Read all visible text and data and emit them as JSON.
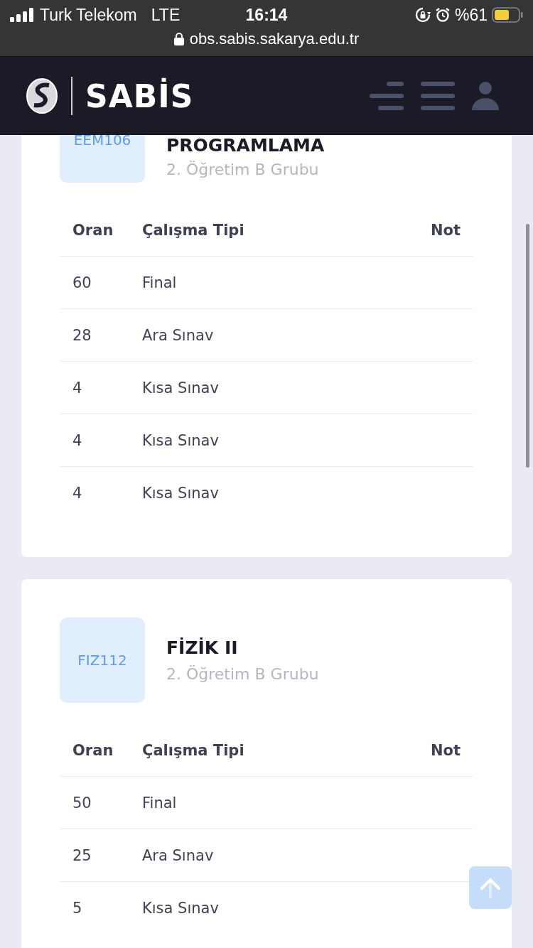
{
  "status_bar": {
    "carrier": "Turk Telekom",
    "network": "LTE",
    "time": "16:14",
    "battery_text": "%61",
    "url": "obs.sabis.sakarya.edu.tr"
  },
  "header": {
    "logo_text": "SABİS"
  },
  "courses": [
    {
      "code": "EEM106",
      "title": "PROGRAMLAMA",
      "group": "2. Öğretim B Grubu",
      "columns": [
        "Oran",
        "Çalışma Tipi",
        "Not"
      ],
      "rows": [
        {
          "rate": "60",
          "type": "Final"
        },
        {
          "rate": "28",
          "type": "Ara Sınav"
        },
        {
          "rate": "4",
          "type": "Kısa Sınav"
        },
        {
          "rate": "4",
          "type": "Kısa Sınav"
        },
        {
          "rate": "4",
          "type": "Kısa Sınav"
        }
      ]
    },
    {
      "code": "FIZ112",
      "title": "FİZİK II",
      "group": "2. Öğretim B Grubu",
      "columns": [
        "Oran",
        "Çalışma Tipi",
        "Not"
      ],
      "rows": [
        {
          "rate": "50",
          "type": "Final"
        },
        {
          "rate": "25",
          "type": "Ara Sınav"
        },
        {
          "rate": "5",
          "type": "Kısa Sınav"
        }
      ]
    }
  ]
}
